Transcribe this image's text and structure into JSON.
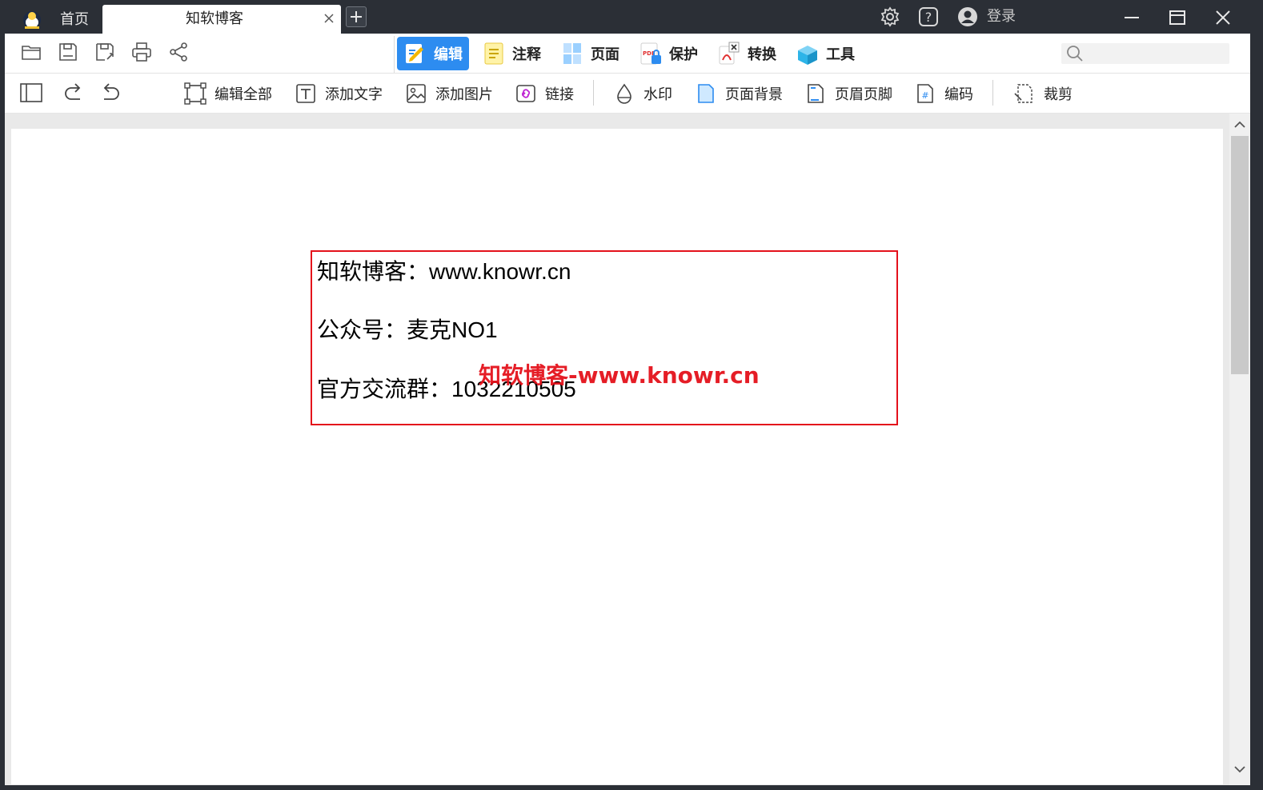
{
  "titlebar": {
    "home_tab": "首页",
    "doc_tab": "知软博客",
    "login_label": "登录"
  },
  "ribbon": {
    "tabs": [
      {
        "label": "编辑",
        "icon": "edit-icon",
        "active": true
      },
      {
        "label": "注释",
        "icon": "annotate-icon"
      },
      {
        "label": "页面",
        "icon": "page-icon"
      },
      {
        "label": "保护",
        "icon": "protect-icon"
      },
      {
        "label": "转换",
        "icon": "convert-icon"
      },
      {
        "label": "工具",
        "icon": "tools-icon"
      }
    ],
    "search_placeholder": ""
  },
  "toolbar": {
    "edit_all": "编辑全部",
    "add_text": "添加文字",
    "add_image": "添加图片",
    "link": "链接",
    "watermark": "水印",
    "page_background": "页面背景",
    "header_footer": "页眉页脚",
    "encode": "编码",
    "crop": "裁剪"
  },
  "document": {
    "line1": "知软博客：www.knowr.cn",
    "line2": "公众号：麦克NO1",
    "line3": "官方交流群：1032210505",
    "watermark": "知软博客-www.knowr.cn"
  },
  "colors": {
    "accent": "#2d8cf0",
    "frame": "#2b2f36",
    "highlight_red": "#e4111b"
  }
}
